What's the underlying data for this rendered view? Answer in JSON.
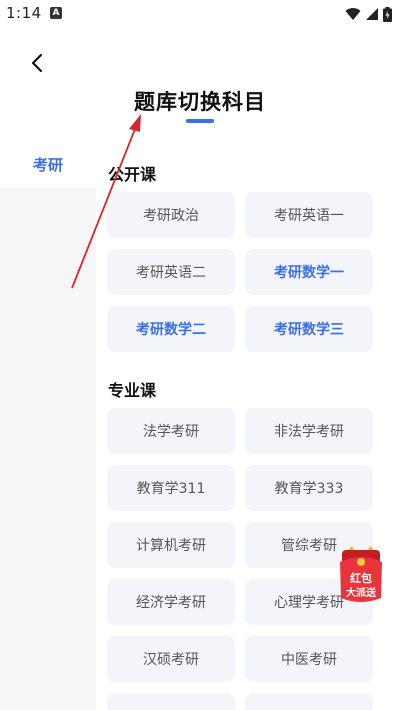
{
  "status_bar": {
    "time": "1:14",
    "app_icon_letter": "A"
  },
  "header": {
    "title": "题库切换科目"
  },
  "sidebar": {
    "items": [
      {
        "label": "考研"
      }
    ]
  },
  "sections": [
    {
      "title": "公开课",
      "items": [
        {
          "label": "考研政治",
          "active": false
        },
        {
          "label": "考研英语一",
          "active": false
        },
        {
          "label": "考研英语二",
          "active": false
        },
        {
          "label": "考研数学一",
          "active": true
        },
        {
          "label": "考研数学二",
          "active": true
        },
        {
          "label": "考研数学三",
          "active": true
        }
      ]
    },
    {
      "title": "专业课",
      "items": [
        {
          "label": "法学考研",
          "active": false
        },
        {
          "label": "非法学考研",
          "active": false
        },
        {
          "label": "教育学311",
          "active": false
        },
        {
          "label": "教育学333",
          "active": false
        },
        {
          "label": "计算机考研",
          "active": false
        },
        {
          "label": "管综考研",
          "active": false
        },
        {
          "label": "经济学考研",
          "active": false
        },
        {
          "label": "心理学考研",
          "active": false
        },
        {
          "label": "汉硕考研",
          "active": false
        },
        {
          "label": "中医考研",
          "active": false
        }
      ]
    }
  ],
  "red_packet": {
    "line1": "红包",
    "line2": "大派送"
  },
  "colors": {
    "accent": "#3b6fe8",
    "chip_bg": "#f3f5fb",
    "arrow": "#d8242c",
    "red_packet": "#e8343a"
  },
  "icons": {
    "back": "chevron-left-icon",
    "wifi": "wifi-icon",
    "signal": "signal-icon",
    "battery": "battery-icon"
  }
}
